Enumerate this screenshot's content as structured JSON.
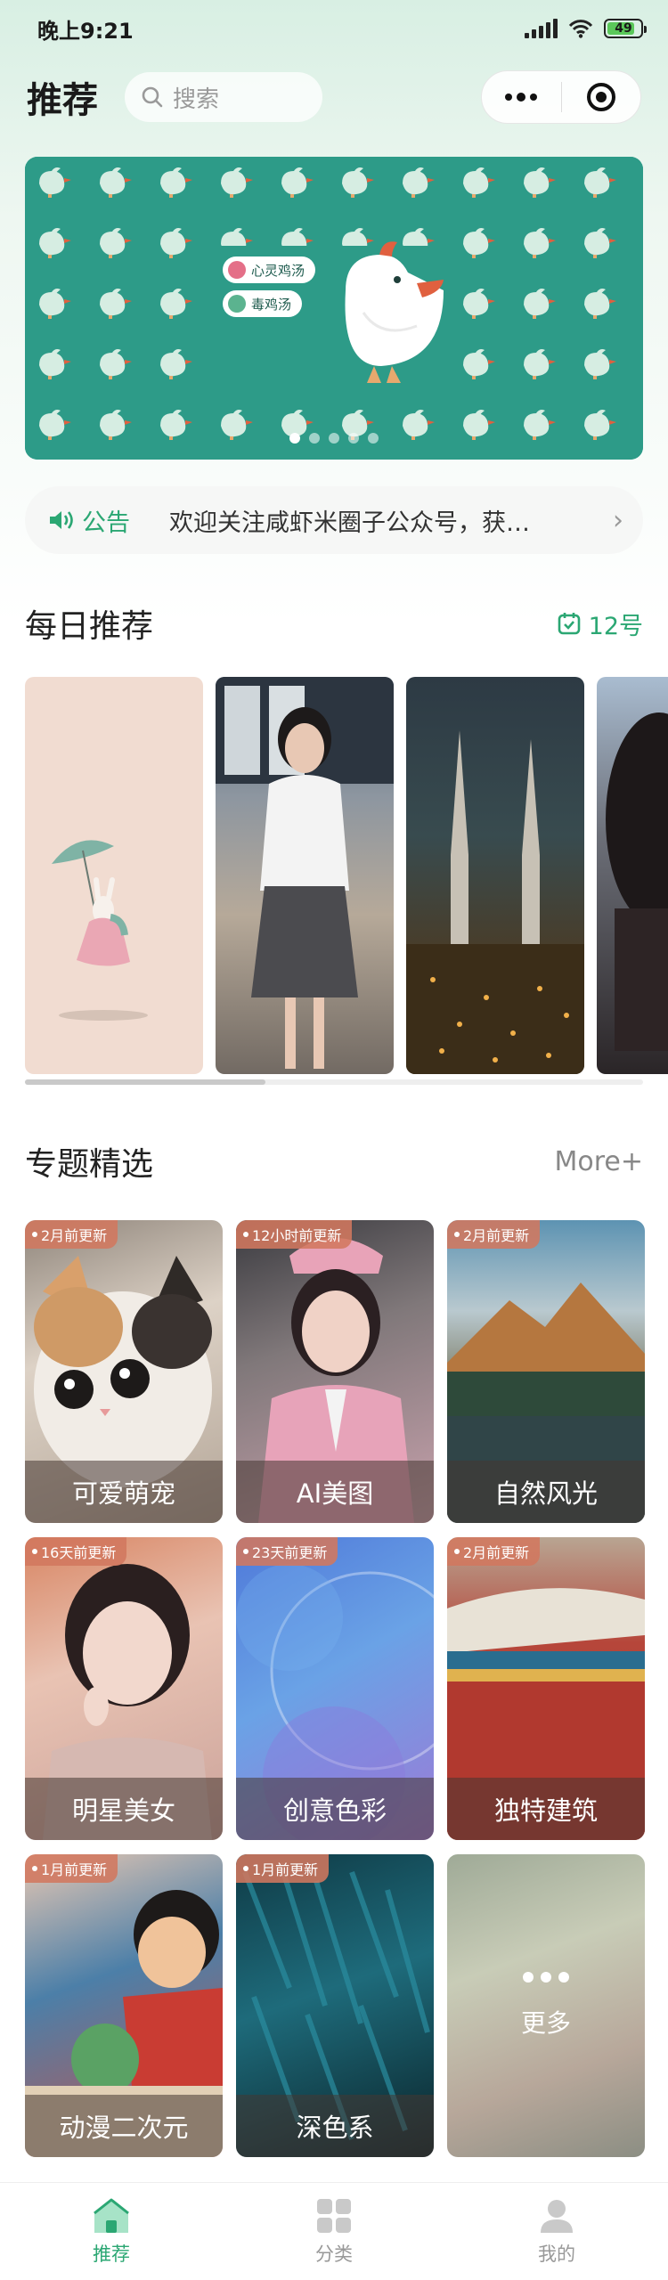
{
  "status_bar": {
    "time": "晚上9:21",
    "battery": "49"
  },
  "header": {
    "title": "推荐",
    "search_placeholder": "搜索"
  },
  "banner": {
    "bubbles": [
      "心灵鸡汤",
      "毒鸡汤"
    ],
    "colors": {
      "background": "#2d9b88",
      "chick": "#d6ede2",
      "beak": "#e0603f"
    }
  },
  "notice": {
    "tag": "公告",
    "text": "欢迎关注咸虾米圈子公众号，获…"
  },
  "daily": {
    "title": "每日推荐",
    "date": "12号"
  },
  "topics": {
    "title": "专题精选",
    "more": "More+",
    "items": [
      {
        "badge": "2月前更新",
        "label": "可爱萌宠"
      },
      {
        "badge": "12小时前更新",
        "label": "AI美图"
      },
      {
        "badge": "2月前更新",
        "label": "自然风光"
      },
      {
        "badge": "16天前更新",
        "label": "明星美女"
      },
      {
        "badge": "23天前更新",
        "label": "创意色彩"
      },
      {
        "badge": "2月前更新",
        "label": "独特建筑"
      },
      {
        "badge": "1月前更新",
        "label": "动漫二次元"
      },
      {
        "badge": "1月前更新",
        "label": "深色系"
      }
    ],
    "more_card_label": "更多"
  },
  "tabbar": {
    "items": [
      "推荐",
      "分类",
      "我的"
    ]
  },
  "accent_color": "#2ba773"
}
